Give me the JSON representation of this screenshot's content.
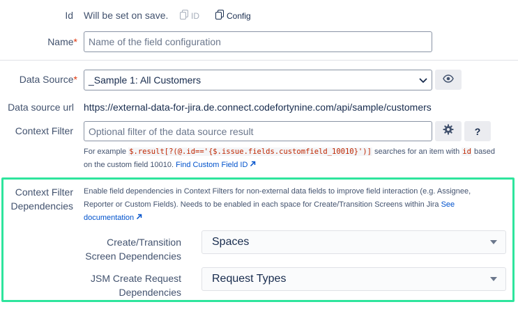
{
  "id_row": {
    "label": "Id",
    "value": "Will be set on save.",
    "id_button": "ID",
    "config_button": "Config"
  },
  "name_row": {
    "label": "Name",
    "required_mark": "*",
    "placeholder": "Name of the field configuration"
  },
  "data_source_row": {
    "label": "Data Source",
    "required_mark": "*",
    "selected": "_Sample 1: All Customers"
  },
  "data_source_url_row": {
    "label": "Data source url",
    "value": "https://external-data-for-jira.de.connect.codefortynine.com/api/sample/customers"
  },
  "context_filter_row": {
    "label": "Context Filter",
    "placeholder": "Optional filter of the data source result",
    "help_prefix": "For example",
    "help_code": "$.result[?(@.id=='{$.issue.fields.customfield_10010}')]",
    "help_middle": "searches for an item with",
    "help_code_id": "id",
    "help_suffix_1": "based",
    "help_suffix_2": "on the custom field 10010.",
    "help_link": "Find Custom Field ID",
    "question_label": "?"
  },
  "dependencies_section": {
    "label_line1": "Context Filter",
    "label_line2": "Dependencies",
    "desc_line1": "Enable field dependencies in Context Filters for non-external data fields to improve field interaction (e.g. Assignee,",
    "desc_line2": "Reporter or Custom Fields). Needs to be enabled in each space for Create/Transition Screens within Jira",
    "desc_link_1": "See",
    "desc_link_2": "documentation",
    "create_transition_label_1": "Create/Transition",
    "create_transition_label_2": "Screen Dependencies",
    "create_transition_value": "Spaces",
    "jsm_label_1": "JSM Create Request",
    "jsm_label_2": "Dependencies",
    "jsm_value": "Request Types"
  },
  "colors": {
    "highlight_border": "#2ee59d",
    "link": "#0052cc",
    "required": "#de350b",
    "code": "#bf2600"
  },
  "icons": [
    "copy-icon",
    "eye-icon",
    "gear-icon",
    "external-link-icon",
    "chevron-down-icon"
  ]
}
